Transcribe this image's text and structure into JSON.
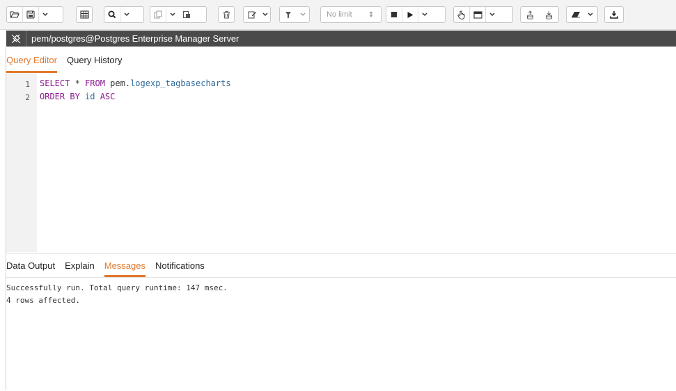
{
  "toolbar": {
    "limit_label": "No limit"
  },
  "connection": {
    "label": "pem/postgres@Postgres Enterprise Manager Server"
  },
  "editor_tabs": [
    "Query Editor",
    "Query History"
  ],
  "editor": {
    "line_numbers": [
      "1",
      "2"
    ],
    "line1": {
      "kw1": "SELECT",
      "op": " * ",
      "kw2": "FROM",
      "schema": " pem.",
      "table": "logexp_tagbasecharts"
    },
    "line2": {
      "kw1": "ORDER BY",
      "col": " id ",
      "kw2": "ASC"
    }
  },
  "output_tabs": [
    "Data Output",
    "Explain",
    "Messages",
    "Notifications"
  ],
  "messages": {
    "line1": "Successfully run. Total query runtime: 147 msec.",
    "line2": "4 rows affected."
  },
  "colors": {
    "accent": "#e0782b",
    "keyword": "#8b1a8f",
    "identifier": "#2f6a9e",
    "connection_bar": "#4a4a4a"
  }
}
